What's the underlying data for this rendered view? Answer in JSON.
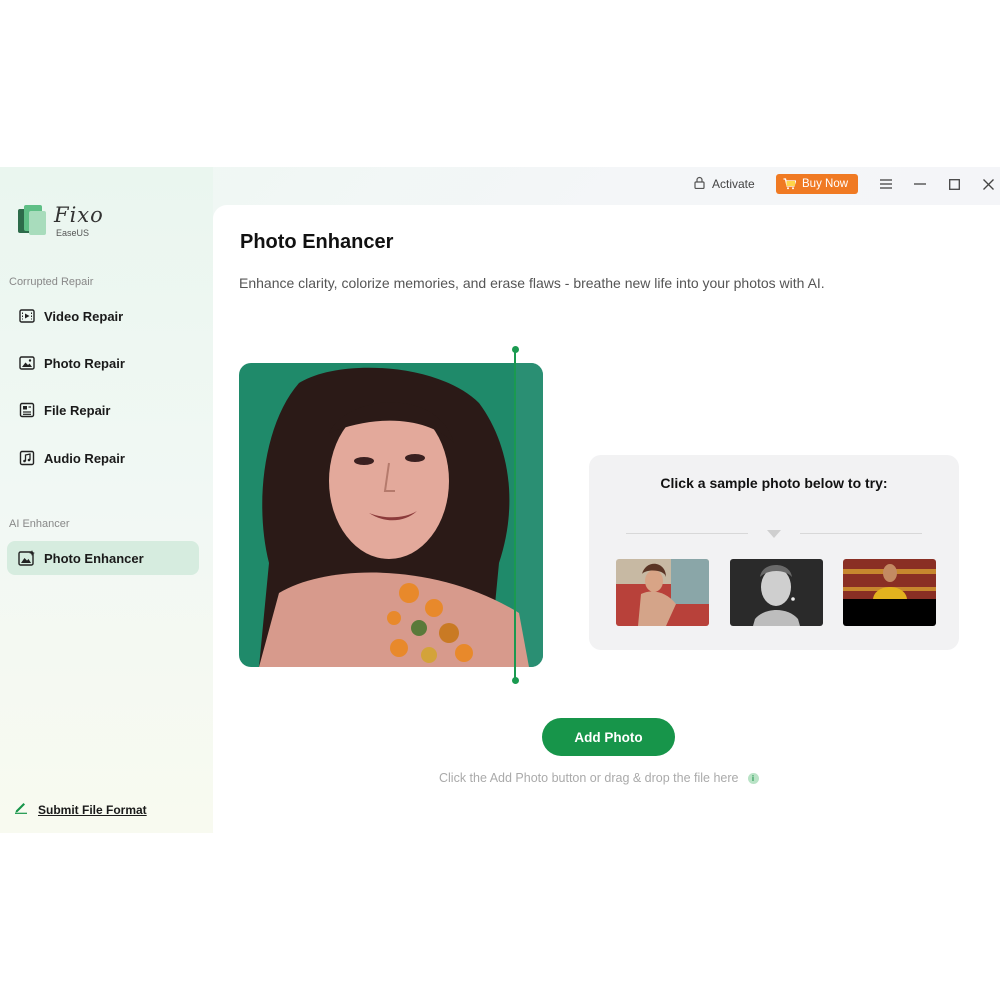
{
  "app": {
    "name": "Fixo",
    "brand": "EaseUS",
    "accent_color": "#17954a",
    "buy_color": "#f07a23"
  },
  "titlebar": {
    "activate_label": "Activate",
    "buy_label": "Buy Now",
    "icons": [
      "lock-icon",
      "cart-icon",
      "menu-icon",
      "minimize-icon",
      "maximize-icon",
      "close-icon"
    ]
  },
  "sidebar": {
    "sections": [
      {
        "label": "Corrupted Repair",
        "items": [
          {
            "label": "Video Repair",
            "icon": "video-icon"
          },
          {
            "label": "Photo Repair",
            "icon": "image-icon"
          },
          {
            "label": "File Repair",
            "icon": "document-icon"
          },
          {
            "label": "Audio Repair",
            "icon": "music-icon"
          }
        ]
      },
      {
        "label": "AI Enhancer",
        "items": [
          {
            "label": "Photo Enhancer",
            "icon": "sparkle-image-icon",
            "active": true
          }
        ]
      }
    ],
    "footer_link": "Submit File Format"
  },
  "main": {
    "title": "Photo Enhancer",
    "subtitle": "Enhance clarity, colorize memories, and erase flaws - breathe new life into your photos with AI.",
    "samples": {
      "title": "Click a sample photo below to try:",
      "thumbnails": [
        "sample-photo-woman-car",
        "sample-photo-man-bw",
        "sample-photo-woman-yellow"
      ]
    },
    "add_button": "Add Photo",
    "hint": "Click the Add Photo button or drag & drop the file here"
  }
}
